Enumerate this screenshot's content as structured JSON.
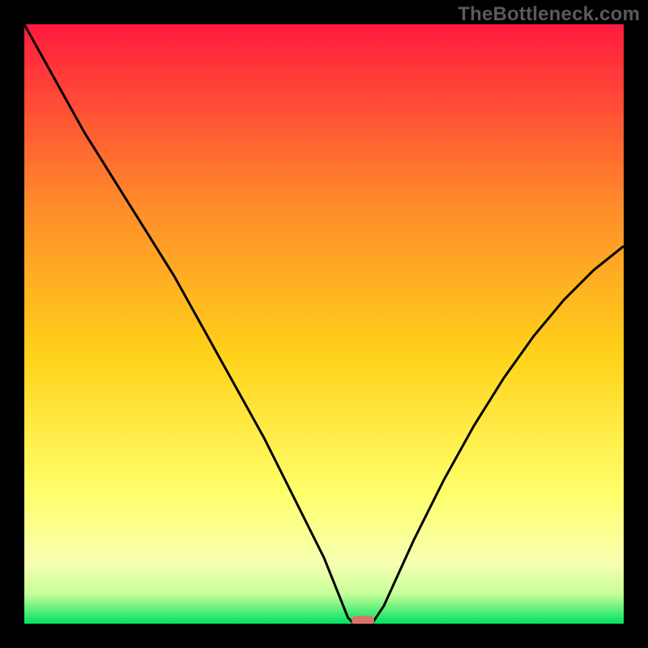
{
  "watermark": "TheBottleneck.com",
  "chart_data": {
    "type": "line",
    "title": "",
    "xlabel": "",
    "ylabel": "",
    "xlim": [
      0,
      100
    ],
    "ylim": [
      0,
      100
    ],
    "x": [
      0,
      5,
      10,
      15,
      20,
      25,
      30,
      35,
      40,
      45,
      50,
      52,
      54,
      55,
      58,
      60,
      65,
      70,
      75,
      80,
      85,
      90,
      95,
      100
    ],
    "values": [
      100,
      91,
      82,
      74,
      66,
      58,
      49,
      40,
      31,
      21,
      11,
      6,
      1,
      0,
      0,
      3,
      14,
      24,
      33,
      41,
      48,
      54,
      59,
      63
    ],
    "marker": {
      "x": 56.5,
      "y": 0.5,
      "color": "#d9756c"
    },
    "gradient_top": "#ff1a3f",
    "gradient_mid_upper": "#ff8b2a",
    "gradient_mid": "#ffd21a",
    "gradient_mid_lower": "#ffff6a",
    "gradient_low1": "#f6ffb0",
    "gradient_low2": "#c8ff9a",
    "gradient_bottom": "#00e261",
    "curve_color": "#000000"
  }
}
